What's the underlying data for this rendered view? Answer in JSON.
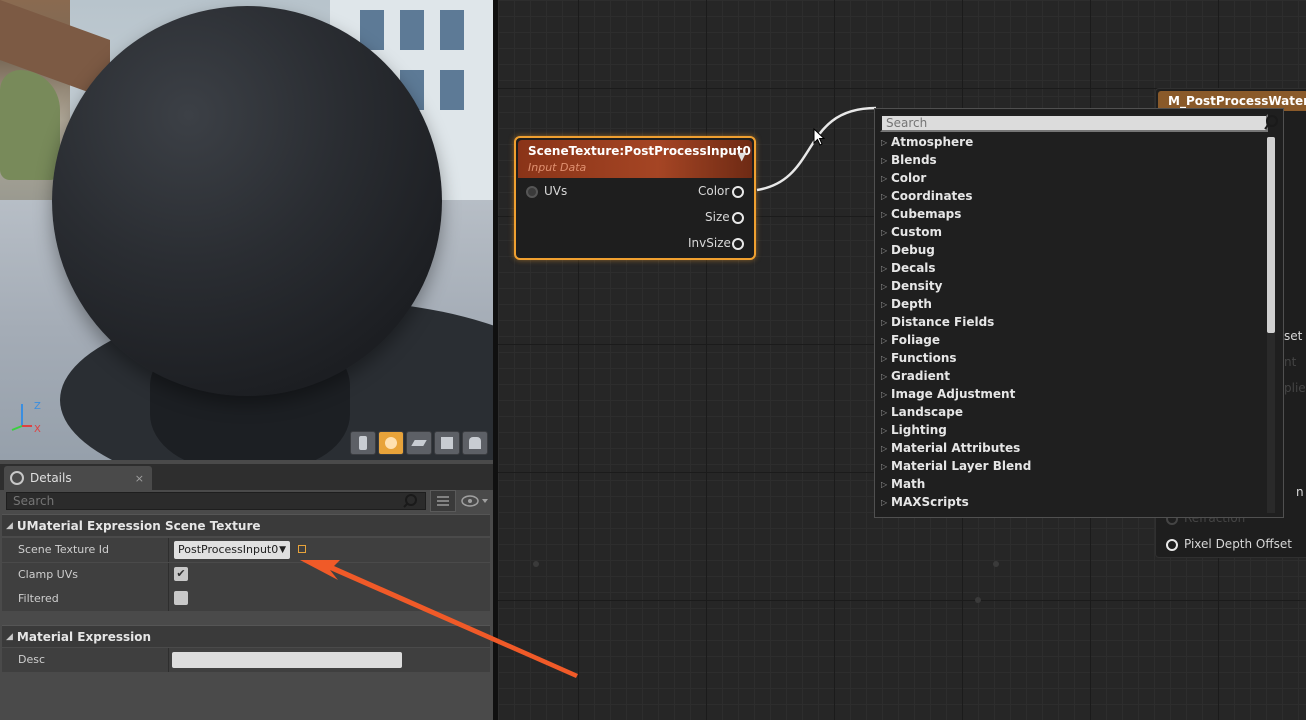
{
  "viewport": {
    "axis_z": "Z",
    "axis_x": "X",
    "preview_buttons": [
      "cylinder-icon",
      "sphere-icon",
      "plane-icon",
      "cube-icon",
      "custom-mesh-icon"
    ]
  },
  "details": {
    "tab_label": "Details",
    "tab_close": "×",
    "search_placeholder": "Search",
    "section1": "UMaterial Expression Scene Texture",
    "scene_texture_id_label": "Scene Texture Id",
    "scene_texture_id_value": "PostProcessInput0",
    "clamp_uvs_label": "Clamp UVs",
    "clamp_uvs_checked": true,
    "filtered_label": "Filtered",
    "filtered_checked": false,
    "section2": "Material Expression",
    "desc_label": "Desc",
    "desc_value": ""
  },
  "node": {
    "title": "SceneTexture:PostProcessInput0",
    "subtitle": "Input Data",
    "input_uvs": "UVs",
    "output_color": "Color",
    "output_size": "Size",
    "output_invsize": "InvSize"
  },
  "material_node": {
    "title": "M_PostProcessWater",
    "pin_partial_1": "set",
    "pin_partial_2": "nt",
    "pin_partial_3": "plier",
    "pin_partial_4": "n",
    "pin_refraction": "Refraction",
    "pin_pixel_depth_offset": "Pixel Depth Offset"
  },
  "context_menu": {
    "search_placeholder": "Search",
    "items": [
      "Atmosphere",
      "Blends",
      "Color",
      "Coordinates",
      "Cubemaps",
      "Custom",
      "Debug",
      "Decals",
      "Density",
      "Depth",
      "Distance Fields",
      "Foliage",
      "Functions",
      "Gradient",
      "Image Adjustment",
      "Landscape",
      "Lighting",
      "Material Attributes",
      "Material Layer Blend",
      "Math",
      "MAXScripts"
    ]
  },
  "colors": {
    "node_border": "#f0a030",
    "node_header": "#a54524",
    "annotation_arrow": "#f05a28",
    "graph_bg": "#262626"
  }
}
